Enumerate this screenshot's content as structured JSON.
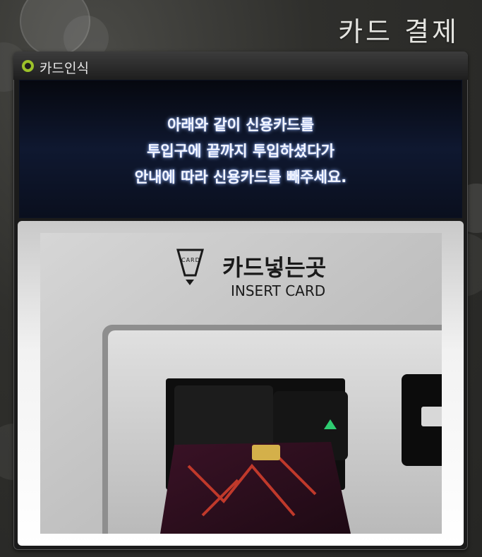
{
  "header": {
    "title": "카드 결제"
  },
  "panel": {
    "label": "카드인식",
    "status_color": "#9cc22a",
    "message": {
      "line1": "아래와 같이 신용카드를",
      "line2": "투입구에 끝까지 투입하셨다가",
      "line3": "안내에 따라 신용카드를 빼주세요."
    }
  },
  "image": {
    "slot_label_ko": "카드넣는곳",
    "slot_label_en": "INSERT CARD",
    "logo_text": "CARD"
  }
}
